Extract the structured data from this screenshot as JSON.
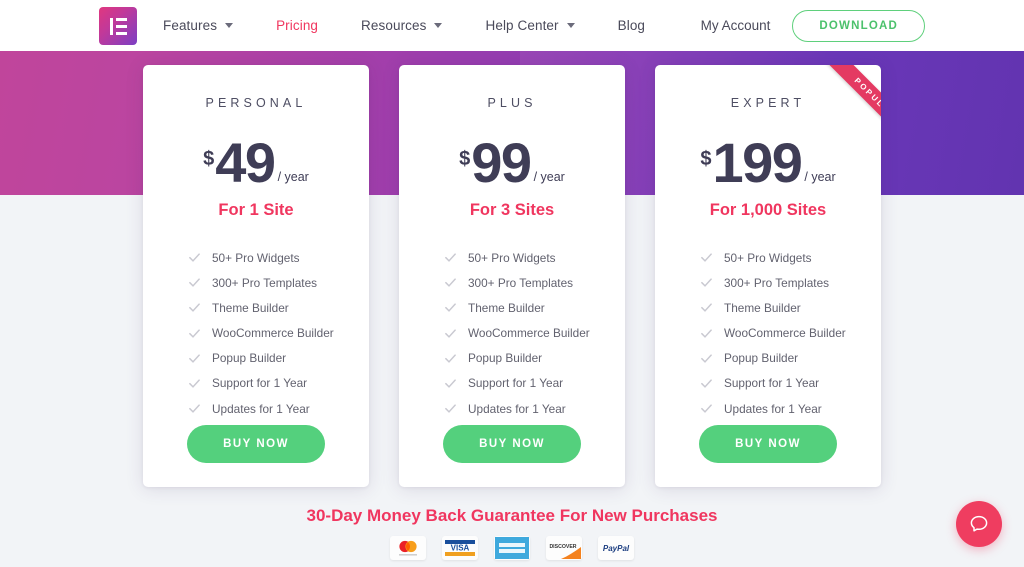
{
  "header": {
    "logo_alt": "elementor-logo",
    "nav": [
      {
        "label": "Features",
        "has_caret": true,
        "active": false
      },
      {
        "label": "Pricing",
        "has_caret": false,
        "active": true
      },
      {
        "label": "Resources",
        "has_caret": true,
        "active": false
      },
      {
        "label": "Help Center",
        "has_caret": true,
        "active": false
      },
      {
        "label": "Blog",
        "has_caret": false,
        "active": false
      }
    ],
    "my_account": "My Account",
    "download": "DOWNLOAD"
  },
  "colors": {
    "accent_pink": "#f0365f",
    "green": "#54d07d",
    "dark_navy": "#3f3d56",
    "gradient_left": "#c0459b",
    "gradient_right": "#6234b0",
    "page_bg": "#f2f4f7",
    "ribbon": "#e43a62"
  },
  "plans": [
    {
      "name": "PERSONAL",
      "currency": "$",
      "amount": "49",
      "period": "/ year",
      "sites": "For 1 Site",
      "popular": false,
      "ribbon_label": "",
      "features": [
        "50+ Pro Widgets",
        "300+ Pro Templates",
        "Theme Builder",
        "WooCommerce Builder",
        "Popup Builder",
        "Support for 1 Year",
        "Updates for 1 Year"
      ],
      "cta": "BUY NOW"
    },
    {
      "name": "PLUS",
      "currency": "$",
      "amount": "99",
      "period": "/ year",
      "sites": "For 3 Sites",
      "popular": false,
      "ribbon_label": "",
      "features": [
        "50+ Pro Widgets",
        "300+ Pro Templates",
        "Theme Builder",
        "WooCommerce Builder",
        "Popup Builder",
        "Support for 1 Year",
        "Updates for 1 Year"
      ],
      "cta": "BUY NOW"
    },
    {
      "name": "EXPERT",
      "currency": "$",
      "amount": "199",
      "period": "/ year",
      "sites": "For 1,000 Sites",
      "popular": true,
      "ribbon_label": "POPULAR",
      "features": [
        "50+ Pro Widgets",
        "300+ Pro Templates",
        "Theme Builder",
        "WooCommerce Builder",
        "Popup Builder",
        "Support for 1 Year",
        "Updates for 1 Year"
      ],
      "cta": "BUY NOW"
    }
  ],
  "footer": {
    "guarantee": "30-Day Money Back Guarantee For New Purchases",
    "payment_methods": [
      {
        "name": "mastercard-icon",
        "label": "mastercard"
      },
      {
        "name": "visa-icon",
        "label": "VISA"
      },
      {
        "name": "amex-icon",
        "label": "AMERICAN EXPRESS"
      },
      {
        "name": "discover-icon",
        "label": "DISCOVER"
      },
      {
        "name": "paypal-icon",
        "label": "PayPal"
      }
    ]
  },
  "chat": {
    "icon": "chat-bubble-icon"
  }
}
